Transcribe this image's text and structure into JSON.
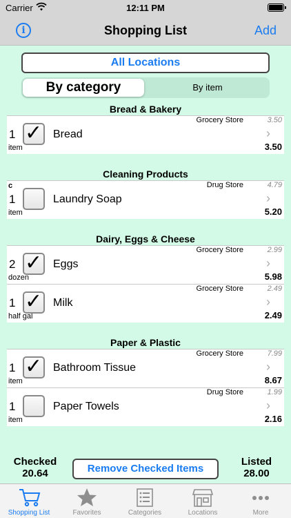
{
  "status": {
    "carrier": "Carrier",
    "time": "12:11 PM"
  },
  "nav": {
    "title": "Shopping List",
    "add": "Add",
    "info": "i"
  },
  "location_button": "All Locations",
  "segments": {
    "by_category": "By category",
    "by_item": "By item"
  },
  "categories": [
    {
      "name": "Bread & Bakery",
      "items": [
        {
          "qty": "1",
          "unit": "item",
          "name": "Bread",
          "checked": true,
          "store": "Grocery Store",
          "last_price": "3.50",
          "price": "3.50",
          "flag": ""
        }
      ]
    },
    {
      "name": "Cleaning Products",
      "items": [
        {
          "qty": "1",
          "unit": "item",
          "name": "Laundry Soap",
          "checked": false,
          "store": "Drug Store",
          "last_price": "4.79",
          "price": "5.20",
          "flag": "c"
        }
      ]
    },
    {
      "name": "Dairy, Eggs & Cheese",
      "items": [
        {
          "qty": "2",
          "unit": "dozen",
          "name": "Eggs",
          "checked": true,
          "store": "Grocery Store",
          "last_price": "2.99",
          "price": "5.98",
          "flag": ""
        },
        {
          "qty": "1",
          "unit": "half gal",
          "name": "Milk",
          "checked": true,
          "store": "Grocery Store",
          "last_price": "2.49",
          "price": "2.49",
          "flag": ""
        }
      ]
    },
    {
      "name": "Paper & Plastic",
      "items": [
        {
          "qty": "1",
          "unit": "item",
          "name": "Bathroom Tissue",
          "checked": true,
          "store": "Grocery Store",
          "last_price": "7.99",
          "price": "8.67",
          "flag": ""
        },
        {
          "qty": "1",
          "unit": "item",
          "name": "Paper Towels",
          "checked": false,
          "store": "Drug Store",
          "last_price": "1.99",
          "price": "2.16",
          "flag": ""
        }
      ]
    }
  ],
  "summary": {
    "checked_label": "Checked",
    "checked_total": "20.64",
    "remove_button": "Remove Checked Items",
    "listed_label": "Listed",
    "listed_total": "28.00"
  },
  "tabs": [
    {
      "label": "Shopping List",
      "icon": "cart-icon",
      "active": true
    },
    {
      "label": "Favorites",
      "icon": "star-icon",
      "active": false
    },
    {
      "label": "Categories",
      "icon": "list-icon",
      "active": false
    },
    {
      "label": "Locations",
      "icon": "store-icon",
      "active": false
    },
    {
      "label": "More",
      "icon": "more-icon",
      "active": false
    }
  ],
  "colors": {
    "accent": "#1a7cf0",
    "background": "#d2fae6",
    "bar": "#d6d6d6"
  }
}
